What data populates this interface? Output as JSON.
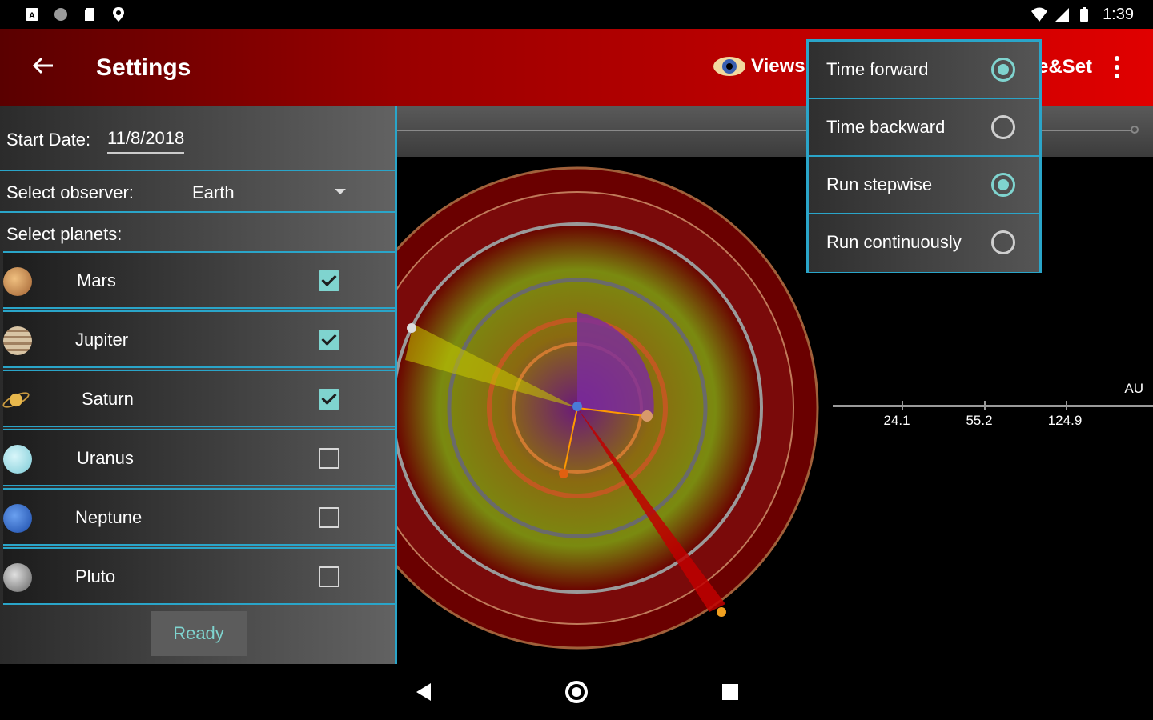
{
  "status_bar": {
    "time": "1:39",
    "icons_left": [
      "notification-a-icon",
      "circle-icon",
      "sd-card-icon",
      "location-icon"
    ],
    "icons_right": [
      "wifi-icon",
      "signal-icon",
      "battery-icon"
    ]
  },
  "app_bar": {
    "title": "Settings",
    "views_label": "Views",
    "riseset_label": "e&Set",
    "accent_color": "#c00000"
  },
  "settings_panel": {
    "start_date_label": "Start Date:",
    "start_date_value": "11/8/2018",
    "observer_label": "Select observer:",
    "observer_value": "Earth",
    "planets_label": "Select planets:",
    "planets": [
      {
        "name": "Mars",
        "checked": true,
        "color": "#c98a4b"
      },
      {
        "name": "Jupiter",
        "checked": true,
        "color": "#cdb79a"
      },
      {
        "name": "Saturn",
        "checked": true,
        "color": "#e0b34f"
      },
      {
        "name": "Uranus",
        "checked": false,
        "color": "#a9e6ee"
      },
      {
        "name": "Neptune",
        "checked": false,
        "color": "#2f6fd6"
      },
      {
        "name": "Pluto",
        "checked": false,
        "color": "#9a9a9a"
      }
    ],
    "ready_label": "Ready"
  },
  "time_menu": {
    "items": [
      {
        "label": "Time forward",
        "selected": true
      },
      {
        "label": "Time backward",
        "selected": false
      },
      {
        "label": "Run stepwise",
        "selected": true
      },
      {
        "label": "Run continuously",
        "selected": false
      }
    ]
  },
  "scale_axis": {
    "unit": "AU",
    "ticks": [
      "24.1",
      "55.2",
      "124.9"
    ]
  }
}
